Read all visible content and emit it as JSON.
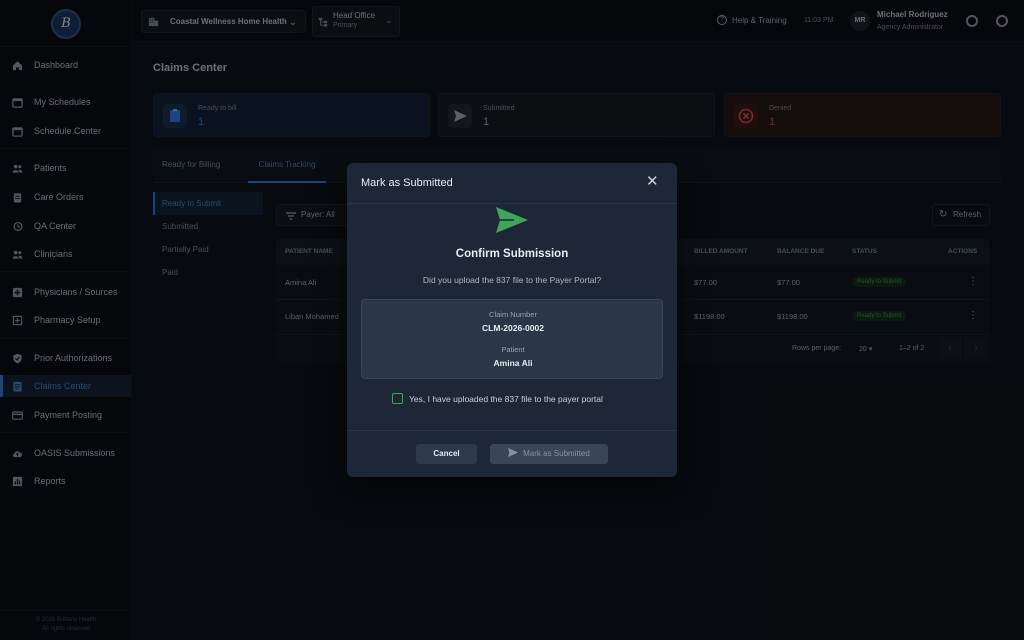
{
  "logo": {
    "initials": "B"
  },
  "sidebar": {
    "items": [
      {
        "label": "Dashboard",
        "icon": "home-icon"
      },
      {
        "label": "My Schedules",
        "icon": "calendar-icon"
      },
      {
        "label": "Schedule Center",
        "icon": "calendar-icon"
      },
      {
        "label": "Patients",
        "icon": "people-icon"
      },
      {
        "label": "Care Orders",
        "icon": "clipboard-icon"
      },
      {
        "label": "QA Center",
        "icon": "history-icon"
      },
      {
        "label": "Clinicians",
        "icon": "people-icon"
      },
      {
        "label": "Physicians / Sources",
        "icon": "medical-plus-icon"
      },
      {
        "label": "Pharmacy Setup",
        "icon": "pharmacy-icon"
      },
      {
        "label": "Prior Authorizations",
        "icon": "shield-check-icon"
      },
      {
        "label": "Claims Center",
        "icon": "document-icon"
      },
      {
        "label": "Payment Posting",
        "icon": "credit-card-icon"
      },
      {
        "label": "OASIS Submissions",
        "icon": "cloud-upload-icon"
      },
      {
        "label": "Reports",
        "icon": "bar-chart-icon"
      }
    ],
    "active": "Claims Center",
    "footer_line1": "© 2026 Brittany Health",
    "footer_line2": "All rights reserved"
  },
  "topbar": {
    "agency": "Coastal Wellness Home Health",
    "office_name": "Head Office",
    "office_sub": "Primary",
    "help": "Help & Training",
    "time": "11:03 PM",
    "avatar_initials": "MR",
    "user_name": "Michael Rodriguez",
    "user_role": "Agency Administrator"
  },
  "page": {
    "title": "Claims Center",
    "cards": [
      {
        "label": "Ready to bill",
        "value": "1",
        "color": "#3b82f6"
      },
      {
        "label": "Submitted",
        "value": "1",
        "color": "#8b949e"
      },
      {
        "label": "Denied",
        "value": "1",
        "color": "#e5534b"
      }
    ],
    "tabs": [
      "Ready for Billing",
      "Claims Tracking"
    ],
    "active_tab": "Claims Tracking",
    "subnav": [
      "Ready to Submit",
      "Submitted",
      "Partially Paid",
      "Paid"
    ],
    "active_subnav": "Ready to Submit",
    "payer_filter": "Payer: All",
    "refresh": "Refresh",
    "table": {
      "headers": [
        "PATIENT NAME",
        "BILLED AMOUNT",
        "BALANCE DUE",
        "STATUS",
        "ACTIONS"
      ],
      "rows": [
        {
          "patient": "Amina Ali",
          "billed": "$77.00",
          "balance": "$77.00",
          "status": "Ready to Submit"
        },
        {
          "patient": "Liban Mohamed",
          "billed": "$1198.00",
          "balance": "$1198.00",
          "status": "Ready to Submit"
        }
      ],
      "rows_per_page_label": "Rows per page:",
      "rows_per_page": "20",
      "range": "1–2 of 2"
    }
  },
  "modal": {
    "title": "Mark as Submitted",
    "heading": "Confirm Submission",
    "question": "Did you upload the 837 file to the Payer Portal?",
    "claim_label": "Claim Number",
    "claim_value": "CLM-2026-0002",
    "patient_label": "Patient",
    "patient_value": "Amina Ali",
    "checkbox_label": "Yes, I have uploaded the 837 file to the payer portal",
    "checkbox_checked": false,
    "cancel": "Cancel",
    "submit": "Mark as Submitted",
    "accent": "#3fa55b"
  }
}
